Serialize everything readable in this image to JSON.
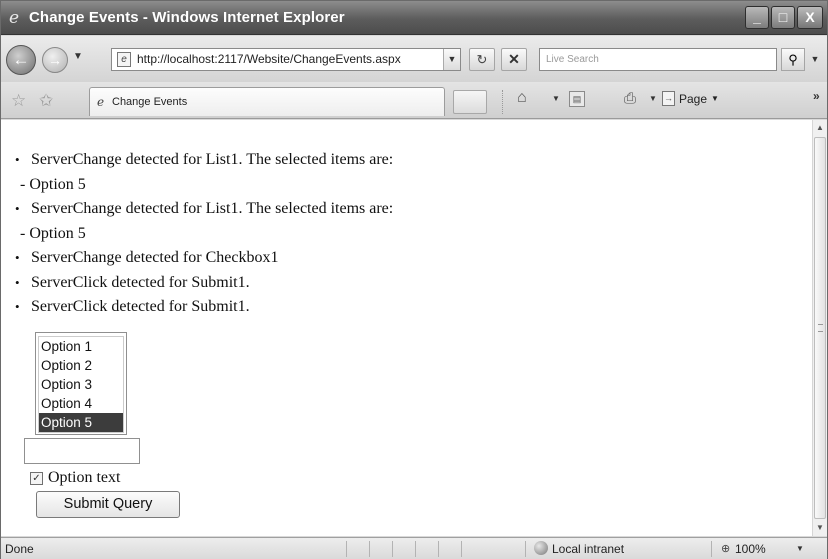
{
  "window": {
    "title": "Change Events - Windows Internet Explorer",
    "minimize_glyph": "_",
    "maximize_glyph": "□",
    "close_glyph": "X"
  },
  "address_bar": {
    "url": "http://localhost:2117/Website/ChangeEvents.aspx",
    "search_placeholder": "Live Search"
  },
  "tab": {
    "label": "Change Events"
  },
  "toolbar": {
    "page_label": "Page"
  },
  "events": [
    {
      "type": "bullet",
      "text": "ServerChange detected for List1. The selected items are:"
    },
    {
      "type": "sub",
      "text": "- Option 5"
    },
    {
      "type": "bullet",
      "text": "ServerChange detected for List1. The selected items are:"
    },
    {
      "type": "sub",
      "text": "- Option 5"
    },
    {
      "type": "bullet",
      "text": "ServerChange detected for Checkbox1"
    },
    {
      "type": "bullet",
      "text": "ServerClick detected for Submit1."
    },
    {
      "type": "bullet",
      "text": "ServerClick detected for Submit1."
    }
  ],
  "list1": {
    "options": [
      "Option 1",
      "Option 2",
      "Option 3",
      "Option 4",
      "Option 5"
    ],
    "selected": "Option 5"
  },
  "text1": {
    "value": ""
  },
  "checkbox1": {
    "checked": true,
    "label": "Option text"
  },
  "submit1": {
    "label": "Submit Query"
  },
  "status": {
    "text": "Done",
    "zone": "Local intranet",
    "zoom": "100%"
  },
  "icons": {
    "back": "back-arrow-icon",
    "forward": "forward-arrow-icon",
    "refresh": "refresh-icon",
    "stop": "stop-icon",
    "search": "magnifier-icon",
    "favorites": "star-icon",
    "add_favorites": "add-favorite-icon",
    "home": "home-icon",
    "feeds": "feeds-icon",
    "print": "printer-icon",
    "page": "page-icon",
    "zone": "globe-icon",
    "zoom": "zoom-icon"
  }
}
